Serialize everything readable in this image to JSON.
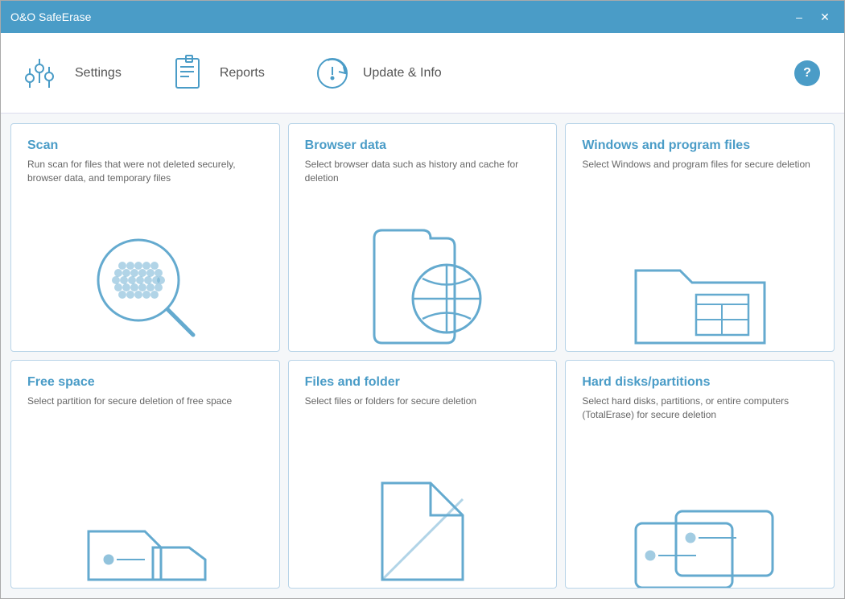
{
  "window": {
    "title": "O&O SafeErase"
  },
  "titlebar": {
    "minimize_label": "–",
    "close_label": "✕"
  },
  "toolbar": {
    "settings_label": "Settings",
    "reports_label": "Reports",
    "update_label": "Update & Info",
    "help_label": "?"
  },
  "tiles": [
    {
      "id": "scan",
      "title": "Scan",
      "desc": "Run scan for files that were not deleted securely, browser data, and temporary files"
    },
    {
      "id": "browser",
      "title": "Browser data",
      "desc": "Select browser data such as history and cache for deletion"
    },
    {
      "id": "windows",
      "title": "Windows and program files",
      "desc": "Select Windows and program files for secure deletion"
    },
    {
      "id": "freespace",
      "title": "Free space",
      "desc": "Select partition for secure deletion of free space"
    },
    {
      "id": "files",
      "title": "Files and folder",
      "desc": "Select files or folders for secure deletion"
    },
    {
      "id": "hardisks",
      "title": "Hard disks/partitions",
      "desc": "Select hard disks, partitions, or entire computers (TotalErase) for secure deletion"
    }
  ]
}
